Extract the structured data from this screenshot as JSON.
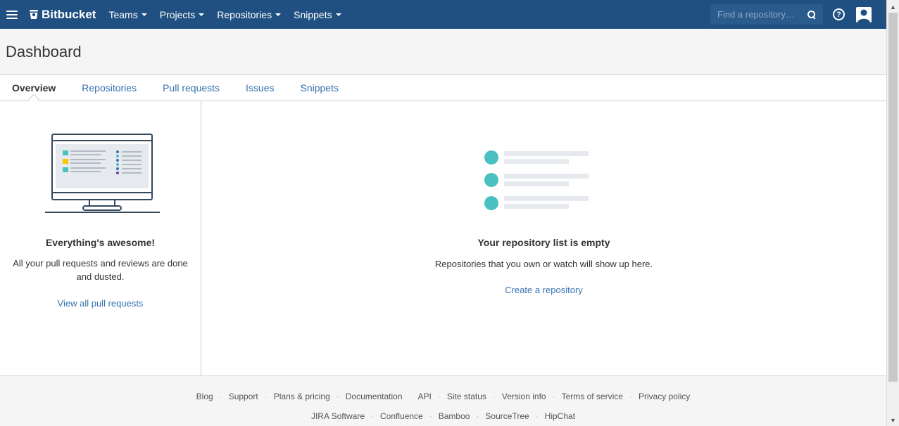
{
  "brand": {
    "name": "Bitbucket"
  },
  "nav": {
    "items": [
      {
        "label": "Teams"
      },
      {
        "label": "Projects"
      },
      {
        "label": "Repositories"
      },
      {
        "label": "Snippets"
      }
    ]
  },
  "search": {
    "placeholder": "Find a repository…"
  },
  "icons": {
    "menu": "hamburger-icon",
    "logo": "bitbucket-logo-icon",
    "search": "search-icon",
    "help": "help-icon",
    "user": "avatar-icon",
    "dropdown": "caret-down-icon"
  },
  "colors": {
    "nav_bg": "#205081",
    "link": "#3572b0",
    "accent_teal": "#4bc0c0",
    "check_yellow": "#ffc400"
  },
  "page": {
    "title": "Dashboard"
  },
  "tabs": [
    {
      "label": "Overview",
      "active": true
    },
    {
      "label": "Repositories"
    },
    {
      "label": "Pull requests"
    },
    {
      "label": "Issues"
    },
    {
      "label": "Snippets"
    }
  ],
  "pull_requests": {
    "heading": "Everything's awesome!",
    "text_line1": "All your pull requests and reviews are done",
    "text_line2": "and dusted.",
    "link": "View all pull requests"
  },
  "repositories": {
    "heading": "Your repository list is empty",
    "text": "Repositories that you own or watch will show up here.",
    "link": "Create a repository"
  },
  "footer": {
    "links_row1": [
      "Blog",
      "Support",
      "Plans & pricing",
      "Documentation",
      "API",
      "Site status",
      "Version info",
      "Terms of service",
      "Privacy policy"
    ],
    "links_row2": [
      "JIRA Software",
      "Confluence",
      "Bamboo",
      "SourceTree",
      "HipChat"
    ],
    "separator": "·"
  }
}
